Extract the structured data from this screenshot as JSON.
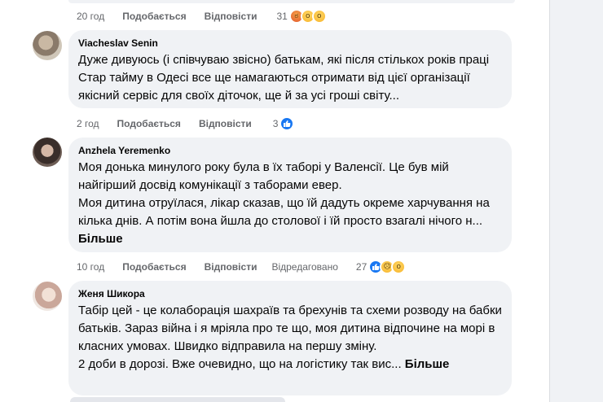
{
  "top_comment": {
    "time": "20 год",
    "like": "Подобається",
    "reply": "Відповісти",
    "count": "31",
    "reactions": [
      "angry-reaction-icon",
      "wow-reaction-icon",
      "wow-reaction-icon"
    ]
  },
  "comments": [
    {
      "author": "Viacheslav Senin",
      "text": "Дуже дивуюсь (і співчуваю звісно) батькам, які після стількох років праці Стар тайму в Одесі все ще намагаються отримати від цієї організації якісний сервіс для своїх діточок, ще й за усі гроші світу...",
      "more": "",
      "time": "2 год",
      "like": "Подобається",
      "reply": "Відповісти",
      "edited": "",
      "count": "3",
      "reactions": [
        "like-reaction-icon"
      ]
    },
    {
      "author": "Anzhela Yeremenko",
      "text": "Моя донька минулого року була в їх таборі у Валенсії. Це був мій найгірший досвід комунікації з таборами евер.\nМоя дитина отруїлася, лікар сказав, що їй дадуть окреме харчування на кілька днів. А потім вона йшла до столової і їй просто взагалі нічого н... ",
      "more": "Більше",
      "time": "10 год",
      "like": "Подобається",
      "reply": "Відповісти",
      "edited": "Відредаговано",
      "count": "27",
      "reactions": [
        "like-reaction-icon",
        "sad-reaction-icon",
        "wow-reaction-icon"
      ]
    },
    {
      "author": "Женя Шикора",
      "text": "Табір цей - це колаборація шахраїв та брехунів та схеми розводу на бабки батьків. Зараз війна і я мріяла про те що, моя дитина відпочине на морі в класних умовах. Швидко відправила на першу зміну.\n2 доби в дорозі. Вже очевидно, що на логістику так вис... ",
      "more": "Більше",
      "time": "",
      "like": "",
      "reply": "",
      "edited": "",
      "count": "",
      "reactions": []
    }
  ],
  "colors": {
    "bubble": "#f0f2f5",
    "meta_text": "#65676b",
    "like_blue": "#1877f2"
  }
}
